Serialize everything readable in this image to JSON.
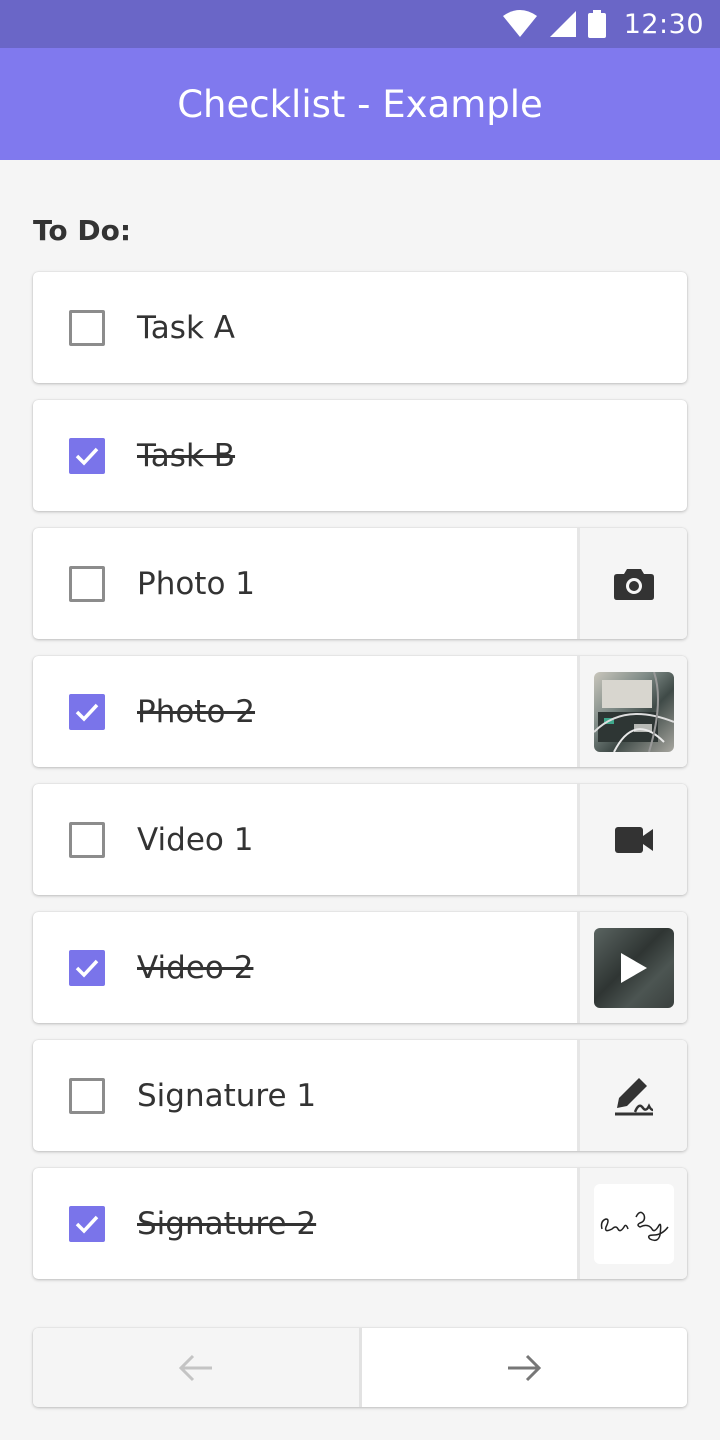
{
  "status_bar": {
    "time": "12:30",
    "icons": [
      "wifi-icon",
      "cellular-signal-icon",
      "battery-icon"
    ]
  },
  "app_bar": {
    "title": "Checklist - Example"
  },
  "section": {
    "title": "To Do:"
  },
  "tasks": [
    {
      "label": "Task A",
      "checked": false,
      "attachment": "none"
    },
    {
      "label": "Task B",
      "checked": true,
      "attachment": "none"
    },
    {
      "label": "Photo 1",
      "checked": false,
      "attachment": "camera-icon"
    },
    {
      "label": "Photo 2",
      "checked": true,
      "attachment": "photo-thumbnail"
    },
    {
      "label": "Video 1",
      "checked": false,
      "attachment": "video-camera-icon"
    },
    {
      "label": "Video 2",
      "checked": true,
      "attachment": "video-thumbnail"
    },
    {
      "label": "Signature 1",
      "checked": false,
      "attachment": "signature-pen-icon"
    },
    {
      "label": "Signature 2",
      "checked": true,
      "attachment": "signature-thumbnail"
    }
  ],
  "navigation": {
    "prev_icon": "arrow-left-icon",
    "next_icon": "arrow-right-icon",
    "prev_enabled": false,
    "next_enabled": true
  },
  "colors": {
    "status_bar": "#6a66c7",
    "app_bar": "#8079ee",
    "accent": "#7a74ea",
    "background": "#f5f5f5"
  }
}
